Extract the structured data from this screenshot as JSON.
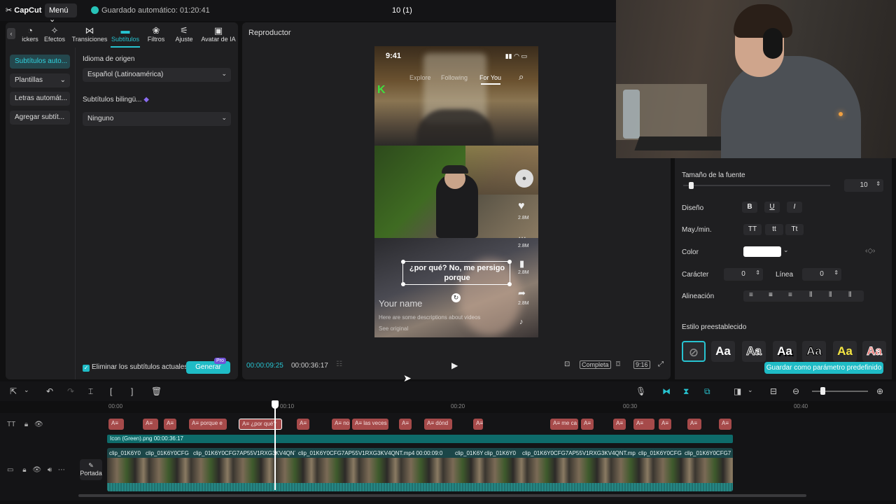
{
  "app": {
    "logo": "CapCut",
    "menu_label": "Menú",
    "autosave": "Guardado automático: 01:20:41",
    "project_title": "10 (1)"
  },
  "tool_tabs": [
    {
      "label": "ickers",
      "icon": "sticker-icon"
    },
    {
      "label": "Efectos",
      "icon": "sparkle-icon"
    },
    {
      "label": "Transiciones",
      "icon": "transition-icon"
    },
    {
      "label": "Subtítulos",
      "icon": "subtitles-icon"
    },
    {
      "label": "Filtros",
      "icon": "filter-icon"
    },
    {
      "label": "Ajuste",
      "icon": "adjust-icon"
    },
    {
      "label": "Avatar de IA",
      "icon": "ai-avatar-icon"
    }
  ],
  "sidenav": [
    "Subtítulos auto...",
    "Plantillas",
    "Letras automát...",
    "Agregar subtít..."
  ],
  "subtitles_panel": {
    "source_lang_label": "Idioma de origen",
    "source_lang_value": "Español (Latinoamérica)",
    "bilingual_label": "Subtítulos bilingü...",
    "bilingual_value": "Ninguno",
    "remove_current_label": "Eliminar los subtítulos actuales",
    "generate_label": "Generar",
    "pro_badge": "Pro"
  },
  "player": {
    "title": "Reproductor",
    "current_time": "00:00:09:25",
    "total_time": "00:00:36:17",
    "full_label": "Completa",
    "ratio_label": "9:16"
  },
  "phone_overlay": {
    "clock": "9:41",
    "tabs": [
      "Explore",
      "Following",
      "For You"
    ],
    "subtitle_text": "¿por qué? No, me persigo porque",
    "like_count": "2.8M",
    "comment_count": "2.8M",
    "save_count": "2.8M",
    "share_count": "2.8M",
    "username": "Your name",
    "description": "Here are some descriptions about videos",
    "see_original": "See original"
  },
  "text_panel": {
    "font_size_label": "Tamaño de la fuente",
    "font_size_value": "10",
    "font_size_fraction": 0.05,
    "design_label": "Diseño",
    "case_label": "May./min.",
    "case_options": [
      "TT",
      "tt",
      "Tt"
    ],
    "color_label": "Color",
    "color_value": "#ffffff",
    "char_label": "Carácter",
    "char_value": "0",
    "line_label": "Línea",
    "line_value": "0",
    "align_label": "Alineación",
    "preset_label": "Estilo preestablecido",
    "preset_sample": "Aa",
    "save_preset_label": "Guardar como parámetro predefinido"
  },
  "timeline": {
    "ruler_labels": [
      "00:00",
      "00:10",
      "00:20",
      "00:30",
      "00:40"
    ],
    "sticker_clip": "Icon (Green).png  00:00:36:17",
    "subtitle_clips": [
      "",
      "",
      "",
      "porque e",
      "¿por qué?",
      "",
      "no",
      "las veces",
      "",
      "dónd",
      "",
      "me ca",
      "",
      "",
      "",
      "",
      "",
      ""
    ],
    "video_clips": [
      "clip_01K6Y0",
      "clip_01K6Y0CFG",
      "clip_01K6Y0CFG7AP55V1RXG3KV4QNT",
      "clip_01K6Y0CFG7AP55V1RXG3KV4QNT.mp4  00:00:09:0",
      "clip_01K6Y",
      "clip_01K6Y0",
      "clip_01K6Y0CFG7AP55V1RXG3KV4QNT.mp4",
      "clip_01K6Y0CFG",
      "clip_01K6Y0CFG7"
    ],
    "cover_label": "Portada"
  },
  "colors": {
    "accent": "#27c3d0",
    "subtitle_clip": "#a64a4a",
    "video_track": "#1b4648"
  }
}
